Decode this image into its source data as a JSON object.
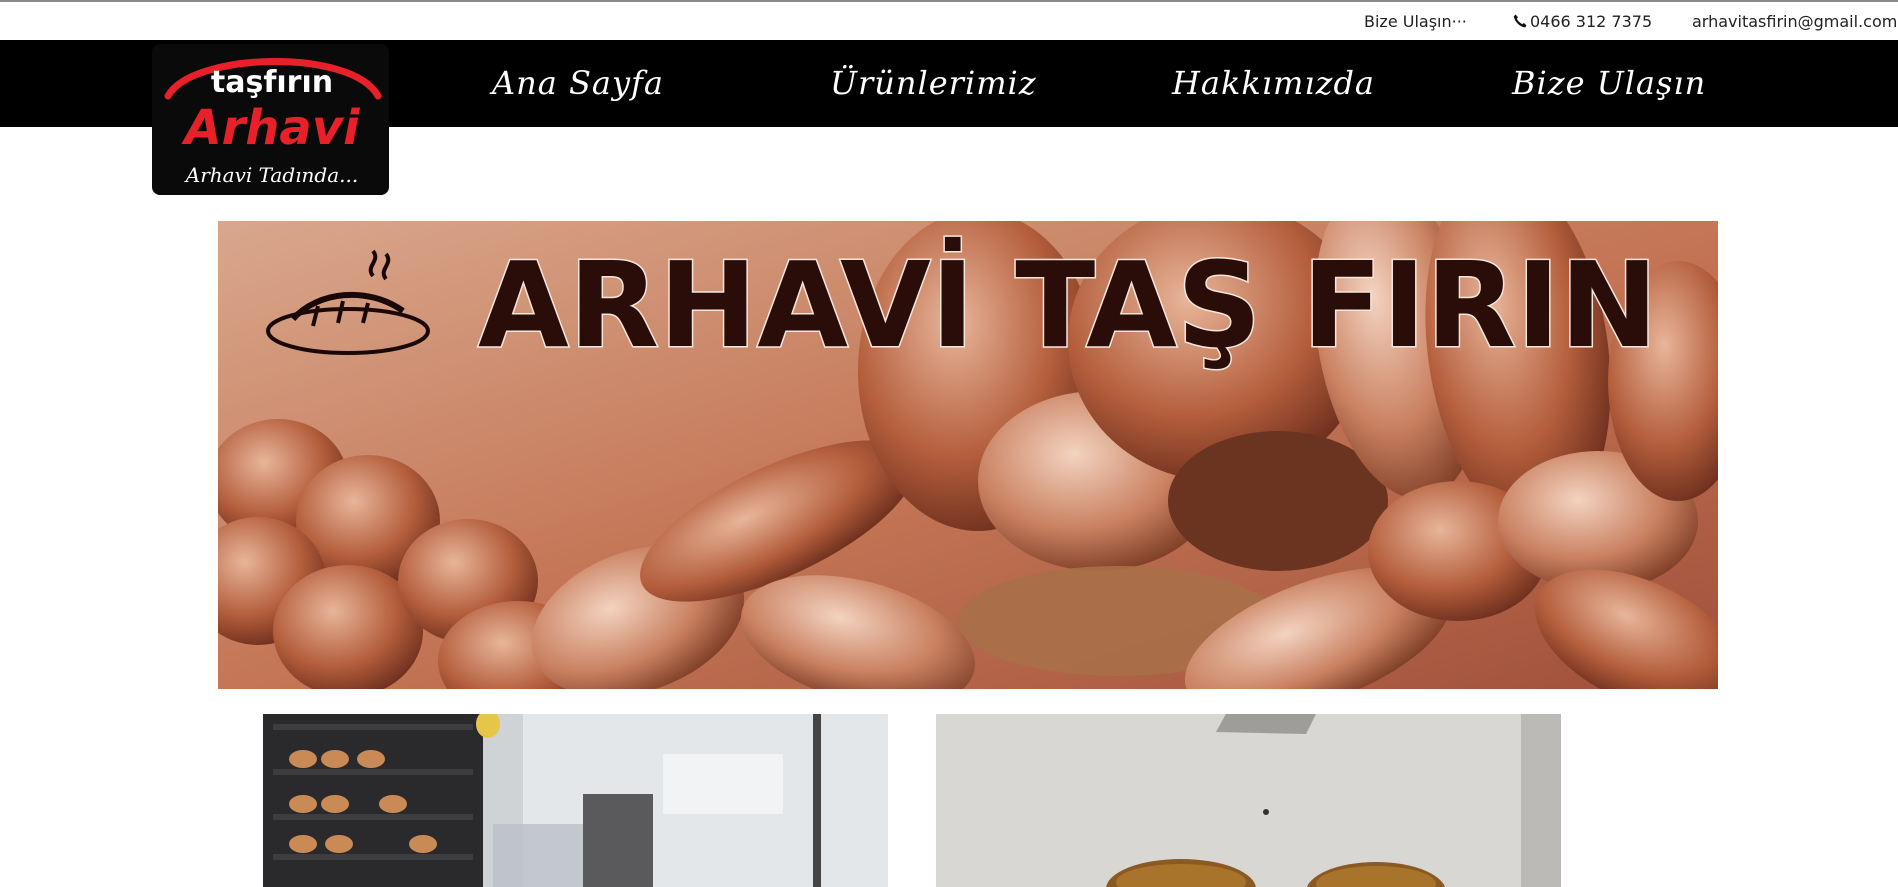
{
  "topbar": {
    "contact_label": "Bize Ulaşın···",
    "phone": "0466 312 7375",
    "email": "arhavitasfirin@gmail.com"
  },
  "nav": {
    "home": "Ana Sayfa",
    "products": "Ürünlerimiz",
    "about": "Hakkımızda",
    "contact": "Bize Ulaşın"
  },
  "logo": {
    "line1": "taşfırın",
    "line2": "Arhavi",
    "tagline": "Arhavi Tadında..."
  },
  "banner": {
    "title": "ARHAVİ TAŞ FIRIN"
  },
  "icons": {
    "phone": "phone-icon"
  },
  "colors": {
    "navbar_bg": "#000000",
    "logo_red": "#e8202a",
    "banner_text": "#2a0c08"
  }
}
